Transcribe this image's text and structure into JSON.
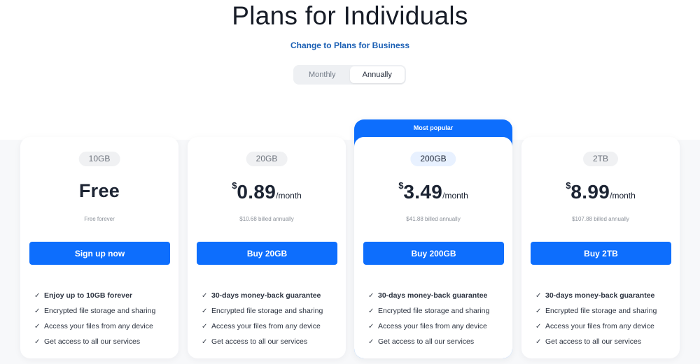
{
  "header": {
    "title": "Plans for Individuals",
    "switch_link": "Change to Plans for Business"
  },
  "billing_toggle": {
    "options": [
      "Monthly",
      "Annually"
    ],
    "selected": "Annually"
  },
  "colors": {
    "accent": "#0d6efd",
    "link": "#1a5fb4"
  },
  "icons": {
    "feature_check": "check-icon"
  },
  "plans": [
    {
      "storage": "10GB",
      "price_label": "Free",
      "subnote": "Free forever",
      "cta": "Sign up now",
      "features": [
        "Enjoy up to 10GB forever",
        "Encrypted file storage and sharing",
        "Access your files from any device",
        "Get access to all our services"
      ]
    },
    {
      "storage": "20GB",
      "currency": "$",
      "amount": "0.89",
      "period": "/month",
      "subnote": "$10.68 billed annually",
      "cta": "Buy 20GB",
      "features": [
        "30-days money-back guarantee",
        "Encrypted file storage and sharing",
        "Access your files from any device",
        "Get access to all our services"
      ]
    },
    {
      "badge": "Most popular",
      "storage": "200GB",
      "currency": "$",
      "amount": "3.49",
      "period": "/month",
      "subnote": "$41.88 billed annually",
      "cta": "Buy 200GB",
      "features": [
        "30-days money-back guarantee",
        "Encrypted file storage and sharing",
        "Access your files from any device",
        "Get access to all our services"
      ]
    },
    {
      "storage": "2TB",
      "currency": "$",
      "amount": "8.99",
      "period": "/month",
      "subnote": "$107.88 billed annually",
      "cta": "Buy 2TB",
      "features": [
        "30-days money-back guarantee",
        "Encrypted file storage and sharing",
        "Access your files from any device",
        "Get access to all our services"
      ]
    }
  ]
}
